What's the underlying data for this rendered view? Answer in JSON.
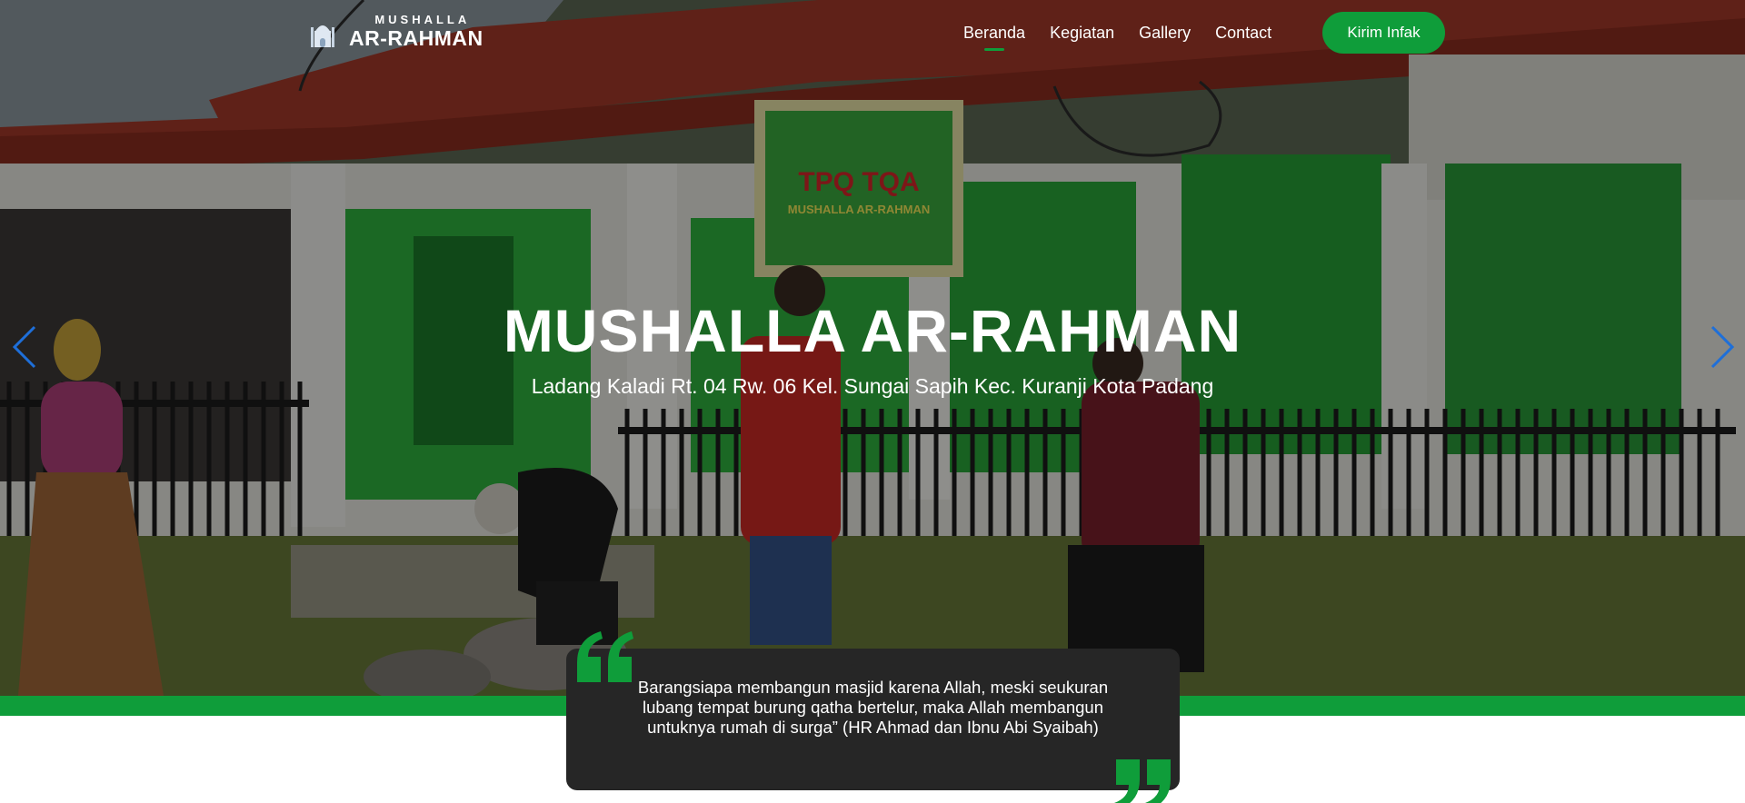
{
  "brand": {
    "top": "MUSHALLA",
    "main": "AR-RAHMAN",
    "logo_icon": "mosque-crescent-icon"
  },
  "nav": {
    "items": [
      {
        "label": "Beranda",
        "active": true
      },
      {
        "label": "Kegiatan",
        "active": false
      },
      {
        "label": "Gallery",
        "active": false
      },
      {
        "label": "Contact",
        "active": false
      }
    ],
    "cta_label": "Kirim Infak"
  },
  "hero": {
    "title": "MUSHALLA AR-RAHMAN",
    "subtitle": "Ladang Kaladi Rt. 04 Rw. 06 Kel. Sungai Sapih Kec. Kuranji Kota Padang",
    "prev_icon": "chevron-left-icon",
    "next_icon": "chevron-right-icon",
    "sign_text": {
      "line1": "TPQ TQA",
      "line2": "MUSHALLA AR-RAHMAN"
    }
  },
  "quote": {
    "text": "Barangsiapa membangun masjid karena Allah, meski seukuran lubang tempat burung qatha bertelur, maka Allah membangun untuknya rumah di surga” (HR Ahmad dan Ibnu Abi Syaibah)",
    "open_icon": "quote-open-icon",
    "close_icon": "quote-close-icon"
  },
  "colors": {
    "accent": "#0f9d3a",
    "card": "#262626",
    "arrow": "#1e6fd9"
  }
}
